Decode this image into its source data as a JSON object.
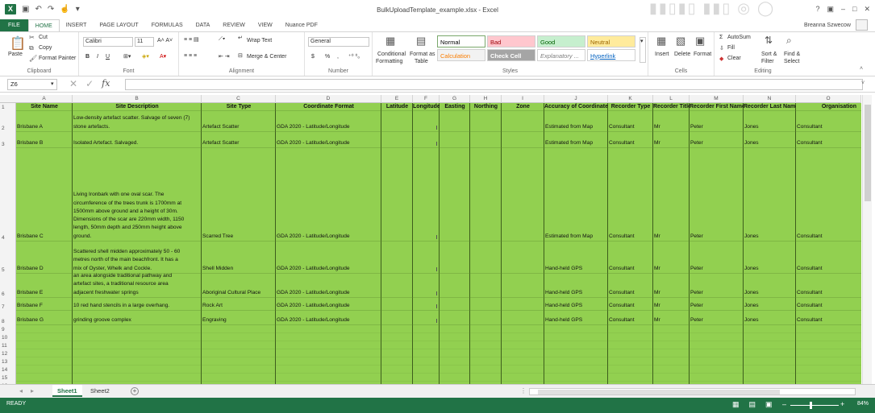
{
  "window": {
    "title": "BulkUploadTemplate_example.xlsx - Excel",
    "user": "Breanna Szwecow",
    "help": "?",
    "minimize": "–",
    "restore": "□",
    "close": "✕"
  },
  "tabs": [
    "FILE",
    "HOME",
    "INSERT",
    "PAGE LAYOUT",
    "FORMULAS",
    "DATA",
    "REVIEW",
    "VIEW",
    "Nuance PDF"
  ],
  "active_tab": "HOME",
  "ribbon": {
    "clipboard": {
      "label": "Clipboard",
      "paste": "Paste",
      "cut": "Cut",
      "copy": "Copy",
      "format_painter": "Format Painter"
    },
    "font": {
      "label": "Font",
      "name": "Calibri",
      "size": "11",
      "bold": "B",
      "italic": "I",
      "underline": "U"
    },
    "alignment": {
      "label": "Alignment",
      "wrap_text": "Wrap Text",
      "merge_center": "Merge & Center"
    },
    "number": {
      "label": "Number",
      "format": "General",
      "currency": "$",
      "percent": "%",
      "comma": ","
    },
    "styles": {
      "label": "Styles",
      "conditional": "Conditional",
      "conditional2": "Formatting",
      "format_as": "Format as",
      "format_as2": "Table",
      "cells": [
        {
          "text": "Normal",
          "bg": "#ffffff",
          "fg": "#000000"
        },
        {
          "text": "Bad",
          "bg": "#ffc7ce",
          "fg": "#9c0006"
        },
        {
          "text": "Good",
          "bg": "#c6efce",
          "fg": "#006100"
        },
        {
          "text": "Neutral",
          "bg": "#ffeb9c",
          "fg": "#9c6500"
        },
        {
          "text": "Calculation",
          "bg": "#f2f2f2",
          "fg": "#fa7d00"
        },
        {
          "text": "Check Cell",
          "bg": "#a5a5a5",
          "fg": "#ffffff"
        },
        {
          "text": "Explanatory ...",
          "bg": "#ffffff",
          "fg": "#7f7f7f"
        },
        {
          "text": "Hyperlink",
          "bg": "#ffffff",
          "fg": "#0563c1"
        }
      ]
    },
    "cells": {
      "label": "Cells",
      "insert": "Insert",
      "delete": "Delete",
      "format": "Format"
    },
    "editing": {
      "label": "Editing",
      "autosum": "AutoSum",
      "fill": "Fill",
      "clear": "Clear",
      "sort": "Sort &",
      "sort2": "Filter",
      "find": "Find &",
      "find2": "Select"
    }
  },
  "formula_bar": {
    "name_box": "Z6",
    "fx": "fx",
    "formula": ""
  },
  "columns": [
    {
      "letter": "A",
      "header": "Site Name"
    },
    {
      "letter": "B",
      "header": "Site Description"
    },
    {
      "letter": "C",
      "header": "Site Type"
    },
    {
      "letter": "D",
      "header": "Coordinate Format"
    },
    {
      "letter": "E",
      "header": "Latitude"
    },
    {
      "letter": "F",
      "header": "Longitude"
    },
    {
      "letter": "G",
      "header": "Easting"
    },
    {
      "letter": "H",
      "header": "Northing"
    },
    {
      "letter": "I",
      "header": "Zone"
    },
    {
      "letter": "J",
      "header": "Accuracy of Coordinates"
    },
    {
      "letter": "K",
      "header": "Recorder Type"
    },
    {
      "letter": "L",
      "header": "Recorder Title"
    },
    {
      "letter": "M",
      "header": "Recorder First Name"
    },
    {
      "letter": "N",
      "header": "Recorder Last Name"
    },
    {
      "letter": "O",
      "header": "Organisation"
    }
  ],
  "rows": [
    {
      "num": "2",
      "name": "Brisbane A",
      "desc": [
        "Low-density artefact scatter. Salvage of seven (7)",
        "stone artefacts."
      ],
      "type": "Artefact Scatter",
      "coord": "GDA 2020 - Latitude/Longitude",
      "accuracy": "Estimated from Map",
      "rtype": "Consultant",
      "title": "Mr",
      "first": "Peter",
      "last": "Jones",
      "org": "Consultant"
    },
    {
      "num": "3",
      "name": "Brisbane B",
      "desc": [
        "Isolated Artefact. Salvaged."
      ],
      "type": "Artefact Scatter",
      "coord": "GDA 2020 - Latitude/Longitude",
      "accuracy": "Estimated from Map",
      "rtype": "Consultant",
      "title": "Mr",
      "first": "Peter",
      "last": "Jones",
      "org": "Consultant"
    },
    {
      "num": "4",
      "name": "Brisbane C",
      "desc": [
        "Living Ironbark with one oval scar. The",
        "circumference of the trees trunk is 1700mm at",
        "1500mm above ground and a height of 30m.",
        "Dimensions of the scar are 220mm width, 1150",
        "length, 50mm depth and 250mm height above",
        "ground."
      ],
      "type": "Scarred Tree",
      "coord": "GDA 2020 - Latitude/Longitude",
      "accuracy": "Estimated from Map",
      "rtype": "Consultant",
      "title": "Mr",
      "first": "Peter",
      "last": "Jones",
      "org": "Consultant"
    },
    {
      "num": "5",
      "name": "Brisbane D",
      "desc": [
        "Scattered shell midden approximately 50 - 60",
        "metres north of the main beachfront.  It has a",
        "mix of Oyster, Whelk and Cockle."
      ],
      "type": "Shell Midden",
      "coord": "GDA 2020 - Latitude/Longitude",
      "accuracy": "Hand-held GPS",
      "rtype": "Consultant",
      "title": "Mr",
      "first": "Peter",
      "last": "Jones",
      "org": "Consultant"
    },
    {
      "num": "6",
      "name": "Brisbane E",
      "desc": [
        "an area alongside traditional pathway and",
        "artefact sites, a traditional resource area",
        "adjacent freshwater springs"
      ],
      "type": "Aboriginal Cultural Place",
      "coord": "GDA 2020 - Latitude/Longitude",
      "accuracy": "Hand-held GPS",
      "rtype": "Consultant",
      "title": "Mr",
      "first": "Peter",
      "last": "Jones",
      "org": "Consultant"
    },
    {
      "num": "7",
      "name": "Brisbane F",
      "desc": [
        "10 red hand stencils in a large overhang."
      ],
      "type": "Rock Art",
      "coord": "GDA 2020 - Latitude/Longitude",
      "accuracy": "Hand-held GPS",
      "rtype": "Consultant",
      "title": "Mr",
      "first": "Peter",
      "last": "Jones",
      "org": "Consultant"
    },
    {
      "num": "8",
      "name": "Brisbane G",
      "desc": [
        "grinding groove complex"
      ],
      "type": "Engraving",
      "coord": "GDA 2020 - Latitude/Longitude",
      "accuracy": "Hand-held GPS",
      "rtype": "Consultant",
      "title": "Mr",
      "first": "Peter",
      "last": "Jones",
      "org": "Consultant"
    }
  ],
  "empty_rows": [
    "9",
    "10",
    "11",
    "12",
    "13",
    "14",
    "15",
    "16"
  ],
  "sheets": [
    "Sheet1",
    "Sheet2"
  ],
  "active_sheet": "Sheet1",
  "add_sheet": "+",
  "status": {
    "ready": "READY",
    "zoom": "84%",
    "minus": "–",
    "plus": "+"
  },
  "colors": {
    "accent": "#217346",
    "fill": "#92d050"
  }
}
